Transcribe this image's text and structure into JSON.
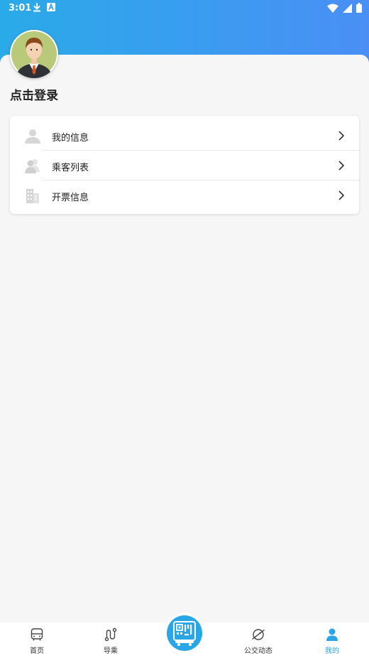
{
  "status_bar": {
    "time": "3:01",
    "left_icons": [
      "download-icon",
      "a-badge-icon"
    ],
    "right_icons": [
      "wifi-icon",
      "cell-signal-icon",
      "battery-icon"
    ]
  },
  "profile": {
    "avatar_icon": "user-avatar-icon",
    "login_text": "点击登录"
  },
  "menu": [
    {
      "label": "我的信息",
      "icon": "person-icon"
    },
    {
      "label": "乘客列表",
      "icon": "passengers-icon"
    },
    {
      "label": "开票信息",
      "icon": "building-icon"
    }
  ],
  "tabbar": {
    "tabs": [
      {
        "label": "首页",
        "icon": "bus-icon"
      },
      {
        "label": "导乘",
        "icon": "route-icon"
      },
      {
        "label": "公交动态",
        "icon": "planet-icon"
      },
      {
        "label": "我的",
        "icon": "person-icon",
        "active": true
      }
    ],
    "center_icon": "qr-bus-icon"
  },
  "colors": {
    "accent": "#2aa6e6",
    "header_gradient_start": "#2aaae8",
    "header_gradient_end": "#4a8ff5",
    "background": "#f6f6f6"
  }
}
